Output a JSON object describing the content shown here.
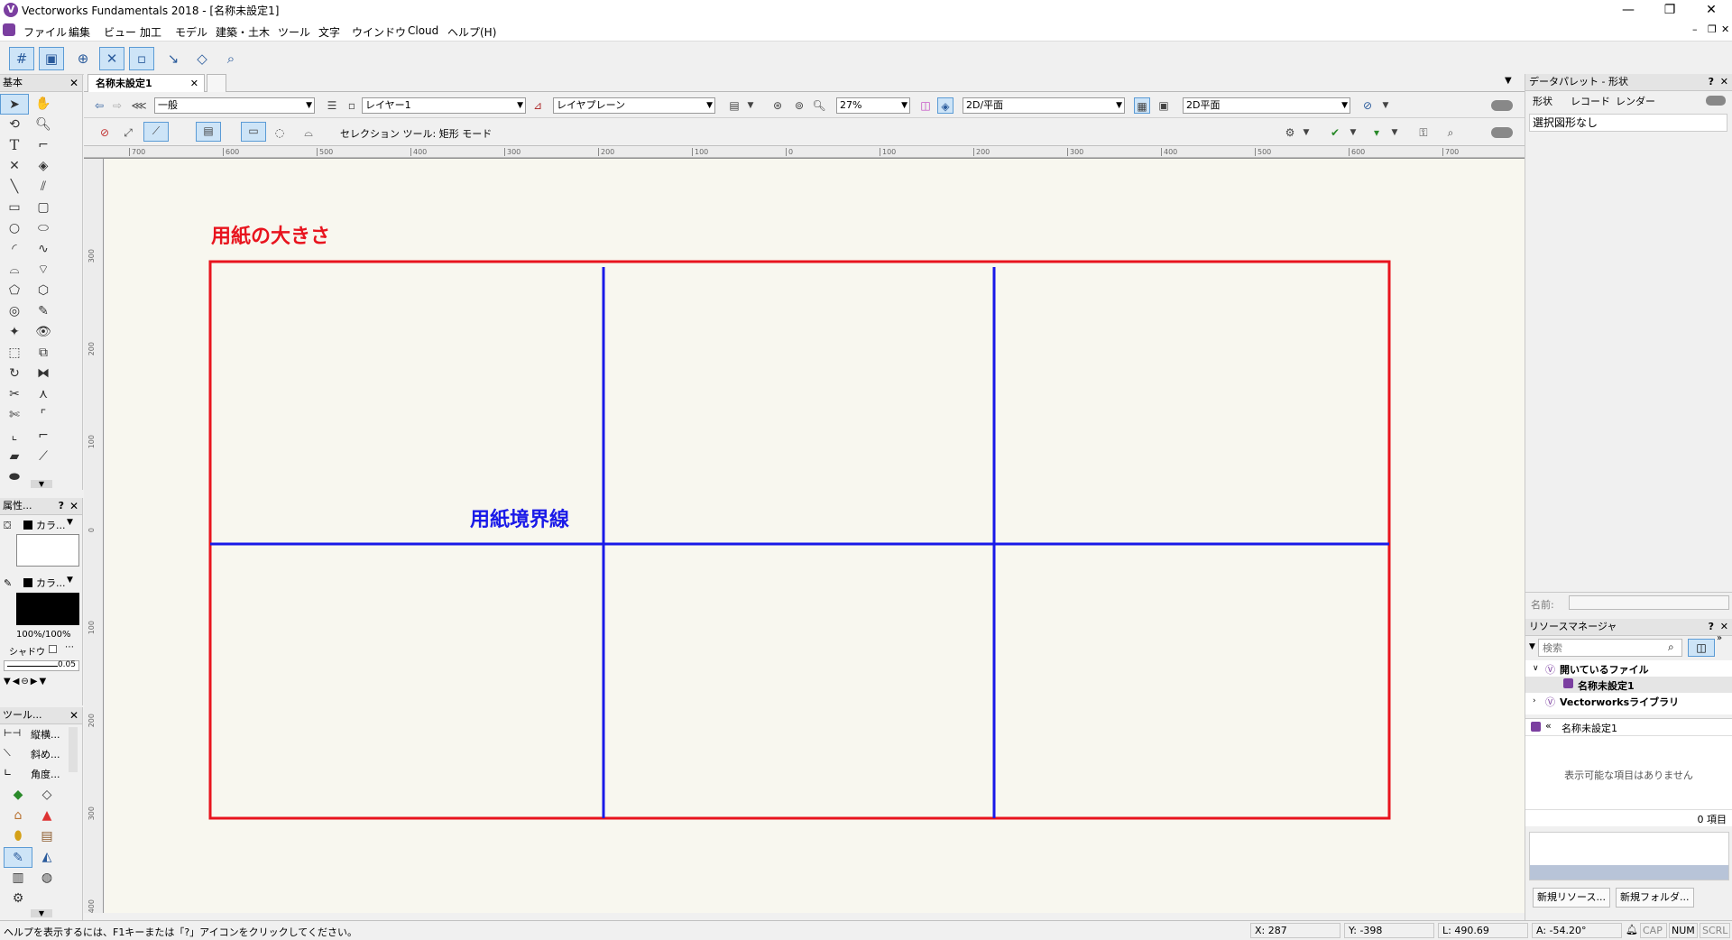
{
  "window": {
    "title": "Vectorworks Fundamentals 2018 - [名称未設定1]",
    "app_icon": "V",
    "minimize": "—",
    "restore": "❐",
    "close": "✕"
  },
  "menu": [
    "ファイル",
    "編集",
    "ビュー",
    "加工",
    "モデル",
    "建築・土木",
    "ツール",
    "文字",
    "ウインドウ",
    "Cloud",
    "ヘルプ(H)"
  ],
  "left_palettes": {
    "basic": {
      "title": "基本",
      "close": "✕"
    },
    "attributes": {
      "title": "属性...",
      "help": "?",
      "close": "✕",
      "fill_label": "カラ...",
      "pen_label": "カラ...",
      "opacity": "100%/100%",
      "shadow_label": "シャドウ",
      "line_weight": "0.05"
    },
    "tool_sets": {
      "title": "ツール...",
      "close": "✕",
      "items": [
        "縦横...",
        "斜め...",
        "角度..."
      ]
    }
  },
  "doc_tab": {
    "label": "名称未設定1",
    "close": "✕"
  },
  "view_bar": {
    "class_value": "一般",
    "layer_value": "レイヤー1",
    "plane_value": "レイヤプレーン",
    "zoom_value": "27%",
    "render_value": "2D/平面",
    "view_value": "2D平面"
  },
  "mode_bar": {
    "mode_text": "セレクション ツール: 矩形 モード"
  },
  "rulers": {
    "h_ticks": [
      "700",
      "600",
      "500",
      "400",
      "300",
      "200",
      "100",
      "0",
      "100",
      "200",
      "300",
      "400",
      "500",
      "600",
      "700"
    ],
    "v_ticks": [
      "300",
      "200",
      "100",
      "0",
      "100",
      "200",
      "300",
      "400"
    ]
  },
  "canvas": {
    "paper_size_label": "用紙の大きさ",
    "paper_boundary_label": "用紙境界線",
    "paper_color": "#e8141e",
    "boundary_color": "#1a1ae8"
  },
  "right_panel": {
    "data_palette": {
      "title": "データパレット - 形状",
      "help": "?",
      "close": "✕",
      "tabs": [
        "形状",
        "レコード",
        "レンダー"
      ],
      "content": "選択図形なし",
      "name_label": "名前:"
    },
    "resource_manager": {
      "title": "リソースマネージャ",
      "help": "?",
      "close": "✕",
      "search_placeholder": "検索",
      "tree_open_files": "開いているファイル",
      "tree_file": "名称未設定1",
      "tree_library": "Vectorworksライブラリ",
      "list_header": "名称未設定1",
      "empty_text": "表示可能な項目はありません",
      "count_text": "0 項目",
      "new_resource_btn": "新規リソース...",
      "new_folder_btn": "新規フォルダ..."
    }
  },
  "status_bar": {
    "help_text": "ヘルプを表示するには、F1キーまたは「?」アイコンをクリックしてください。",
    "x": "X: 287",
    "y": "Y: -398",
    "l": "L: 490.69",
    "a": "A: -54.20°",
    "cap": "CAP",
    "num": "NUM",
    "scrl": "SCRL"
  }
}
